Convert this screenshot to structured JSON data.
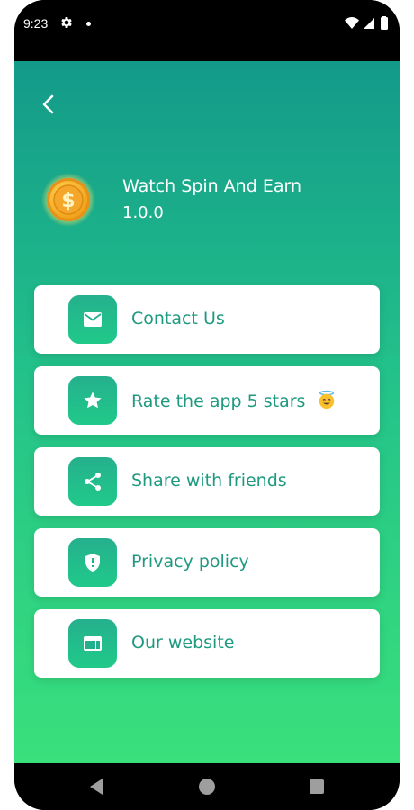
{
  "status_bar": {
    "time": "9:23"
  },
  "header": {
    "app_name": "Watch Spin And Earn",
    "app_version": "1.0.0"
  },
  "menu": {
    "items": [
      {
        "label": "Contact Us",
        "icon": "mail-icon"
      },
      {
        "label": "Rate the app 5 stars",
        "icon": "star-icon"
      },
      {
        "label": "Share with friends",
        "icon": "share-icon"
      },
      {
        "label": "Privacy policy",
        "icon": "shield-icon"
      },
      {
        "label": "Our website",
        "icon": "web-icon"
      }
    ]
  },
  "colors": {
    "gradient_top": "#139a8a",
    "gradient_bottom": "#39e07b",
    "label_color": "#1f9a80"
  }
}
